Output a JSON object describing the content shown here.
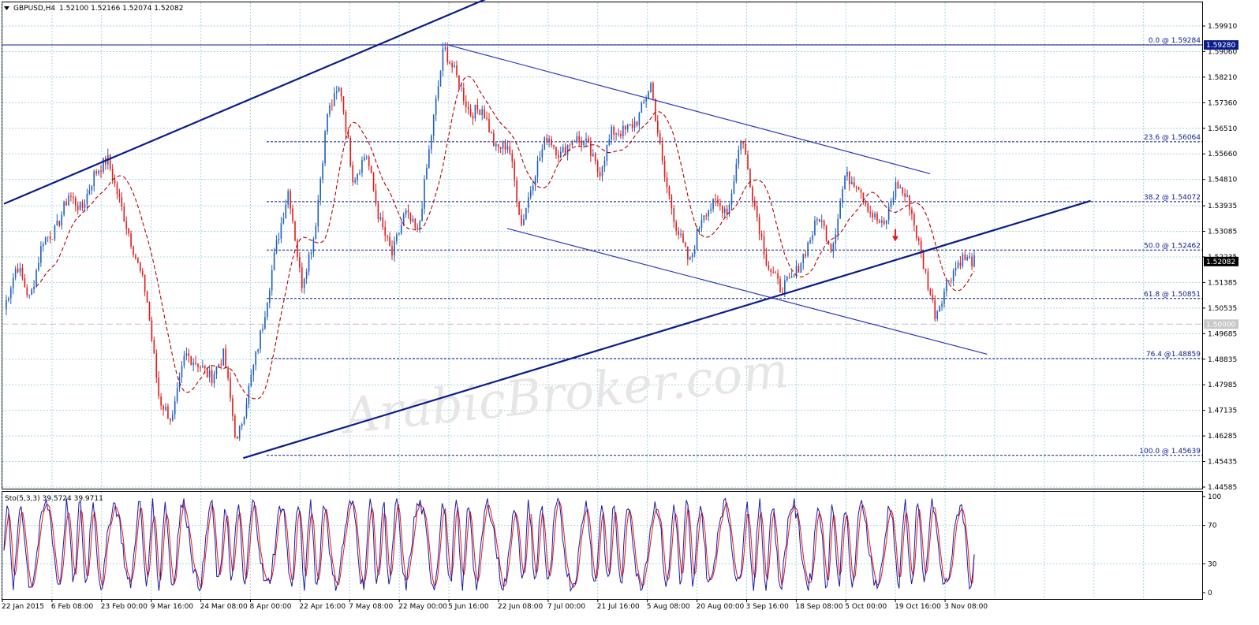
{
  "header": {
    "symbol_label": "GBPUSD,H4",
    "ohlc_label": "1.52100 1.52166 1.52074 1.52082",
    "dropdown_icon": "triangle-down-icon"
  },
  "watermark": "ArabicBroker.com",
  "chart_data": [
    {
      "type": "line",
      "title": "GBPUSD,H4",
      "subtitle": "1.52100 1.52166 1.52074 1.52082",
      "series_style": "candlestick (blue up / red down) with red dashed moving average",
      "ylim": [
        1.44585,
        1.5991
      ],
      "y_ticks": [
        "1.59910",
        "1.59060",
        "1.58210",
        "1.57360",
        "1.56510",
        "1.55660",
        "1.54810",
        "1.53935",
        "1.53085",
        "1.52235",
        "1.51385",
        "1.50535",
        "1.49685",
        "1.48835",
        "1.47985",
        "1.47135",
        "1.46285",
        "1.45435",
        "1.44585"
      ],
      "x_ticks": [
        "22 Jan 2015",
        "6 Feb 08:00",
        "23 Feb 00:00",
        "9 Mar 16:00",
        "24 Mar 08:00",
        "8 Apr 00:00",
        "22 Apr 16:00",
        "7 May 08:00",
        "22 May 00:00",
        "5 Jun 16:00",
        "22 Jun 08:00",
        "7 Jul 00:00",
        "21 Jul 16:00",
        "5 Aug 08:00",
        "20 Aug 00:00",
        "3 Sep 16:00",
        "18 Sep 08:00",
        "5 Oct 00:00",
        "19 Oct 16:00",
        "3 Nov 08:00"
      ],
      "price_keypoints": [
        {
          "t": 0,
          "p": 1.505
        },
        {
          "t": 1,
          "p": 1.52
        },
        {
          "t": 2,
          "p": 1.508
        },
        {
          "t": 3,
          "p": 1.528
        },
        {
          "t": 4,
          "p": 1.531
        },
        {
          "t": 5,
          "p": 1.543
        },
        {
          "t": 6,
          "p": 1.538
        },
        {
          "t": 7,
          "p": 1.55
        },
        {
          "t": 8,
          "p": 1.555
        },
        {
          "t": 9,
          "p": 1.54
        },
        {
          "t": 10,
          "p": 1.525
        },
        {
          "t": 11,
          "p": 1.51
        },
        {
          "t": 12,
          "p": 1.475
        },
        {
          "t": 13,
          "p": 1.468
        },
        {
          "t": 14,
          "p": 1.49
        },
        {
          "t": 15,
          "p": 1.487
        },
        {
          "t": 16,
          "p": 1.482
        },
        {
          "t": 17,
          "p": 1.49
        },
        {
          "t": 18,
          "p": 1.46
        },
        {
          "t": 19,
          "p": 1.48
        },
        {
          "t": 20,
          "p": 1.5
        },
        {
          "t": 21,
          "p": 1.525
        },
        {
          "t": 22,
          "p": 1.545
        },
        {
          "t": 23,
          "p": 1.513
        },
        {
          "t": 24,
          "p": 1.53
        },
        {
          "t": 25,
          "p": 1.57
        },
        {
          "t": 26,
          "p": 1.579
        },
        {
          "t": 27,
          "p": 1.548
        },
        {
          "t": 28,
          "p": 1.557
        },
        {
          "t": 29,
          "p": 1.535
        },
        {
          "t": 30,
          "p": 1.523
        },
        {
          "t": 31,
          "p": 1.537
        },
        {
          "t": 32,
          "p": 1.53
        },
        {
          "t": 33,
          "p": 1.562
        },
        {
          "t": 34,
          "p": 1.592
        },
        {
          "t": 35,
          "p": 1.582
        },
        {
          "t": 36,
          "p": 1.57
        },
        {
          "t": 37,
          "p": 1.572
        },
        {
          "t": 38,
          "p": 1.558
        },
        {
          "t": 39,
          "p": 1.56
        },
        {
          "t": 40,
          "p": 1.533
        },
        {
          "t": 41,
          "p": 1.55
        },
        {
          "t": 42,
          "p": 1.563
        },
        {
          "t": 43,
          "p": 1.556
        },
        {
          "t": 44,
          "p": 1.562
        },
        {
          "t": 45,
          "p": 1.56
        },
        {
          "t": 46,
          "p": 1.55
        },
        {
          "t": 47,
          "p": 1.564
        },
        {
          "t": 48,
          "p": 1.564
        },
        {
          "t": 49,
          "p": 1.568
        },
        {
          "t": 50,
          "p": 1.58
        },
        {
          "t": 51,
          "p": 1.55
        },
        {
          "t": 52,
          "p": 1.532
        },
        {
          "t": 53,
          "p": 1.52
        },
        {
          "t": 54,
          "p": 1.537
        },
        {
          "t": 55,
          "p": 1.54
        },
        {
          "t": 56,
          "p": 1.538
        },
        {
          "t": 57,
          "p": 1.563
        },
        {
          "t": 58,
          "p": 1.54
        },
        {
          "t": 59,
          "p": 1.52
        },
        {
          "t": 60,
          "p": 1.512
        },
        {
          "t": 61,
          "p": 1.515
        },
        {
          "t": 62,
          "p": 1.525
        },
        {
          "t": 63,
          "p": 1.536
        },
        {
          "t": 64,
          "p": 1.525
        },
        {
          "t": 65,
          "p": 1.549
        },
        {
          "t": 66,
          "p": 1.547
        },
        {
          "t": 67,
          "p": 1.537
        },
        {
          "t": 68,
          "p": 1.532
        },
        {
          "t": 69,
          "p": 1.547
        },
        {
          "t": 70,
          "p": 1.54
        },
        {
          "t": 71,
          "p": 1.521
        },
        {
          "t": 72,
          "p": 1.503
        },
        {
          "t": 73,
          "p": 1.515
        },
        {
          "t": 74,
          "p": 1.522
        },
        {
          "t": 75,
          "p": 1.5208
        }
      ],
      "fibonacci_levels": [
        {
          "label": "0.0 @ 1.59284",
          "value": 1.59284
        },
        {
          "label": "23.6 @ 1.56064",
          "value": 1.56064
        },
        {
          "label": "38.2 @ 1.54072",
          "value": 1.54072
        },
        {
          "label": "50.0 @ 1.52462",
          "value": 1.52462
        },
        {
          "label": "61.8 @ 1.50851",
          "value": 1.50851
        },
        {
          "label": "76.4 @1.48859",
          "value": 1.48859
        },
        {
          "label": "100.0 @ 1.45639",
          "value": 1.45639
        }
      ],
      "price_tags": [
        {
          "label": "1.59280",
          "value": 1.5928,
          "color": "#0b1c8a"
        },
        {
          "label": "1.52082",
          "value": 1.52082,
          "color": "#000000"
        },
        {
          "label": "1.50000",
          "value": 1.5,
          "color": "#c8c8c8"
        }
      ],
      "horizontal_lines": [
        {
          "value": 1.5928,
          "style": "solid",
          "color": "#0b1c8a"
        },
        {
          "value": 1.5,
          "style": "dashed",
          "color": "#c0c0c0"
        }
      ],
      "trendlines": [
        {
          "name": "upper-channel",
          "x1": 0,
          "y1": 1.54,
          "x2": 41.6,
          "y2": 1.616,
          "color": "#0b1c8a",
          "width": 2.2
        },
        {
          "name": "lower-channel",
          "x1": 18.5,
          "y1": 1.4555,
          "x2": 84,
          "y2": 1.541,
          "color": "#0b1c8a",
          "width": 2.2
        },
        {
          "name": "falling-upper",
          "x1": 34.3,
          "y1": 1.59284,
          "x2": 71.6,
          "y2": 1.55,
          "color": "#2a38b8",
          "width": 1.2
        },
        {
          "name": "falling-lower",
          "x1": 38.9,
          "y1": 1.5318,
          "x2": 76,
          "y2": 1.49,
          "color": "#2a38b8",
          "width": 1.2
        }
      ],
      "red_arrow_marker": {
        "t": 68.9,
        "p": 1.5285,
        "color": "#e31a1a"
      }
    },
    {
      "type": "line",
      "title": "Sto(5,3,3) 39.5724 39.9711",
      "ylim": [
        0,
        100
      ],
      "y_ticks": [
        "100",
        "70",
        "30",
        "0"
      ],
      "levels": [
        70,
        30
      ],
      "series": [
        {
          "name": "%K",
          "color": "#1a1aa8"
        },
        {
          "name": "%D",
          "color": "#dd1a1a"
        }
      ],
      "last_values": [
        39.5724,
        39.9711
      ]
    }
  ],
  "colors": {
    "grid": "#a8d4e0",
    "bull_candle": "#1f5fbf",
    "bear_candle": "#e31a1a",
    "moving_average": "#b30000",
    "fib_line": "#0b1c8a",
    "axis_text": "#000000"
  }
}
